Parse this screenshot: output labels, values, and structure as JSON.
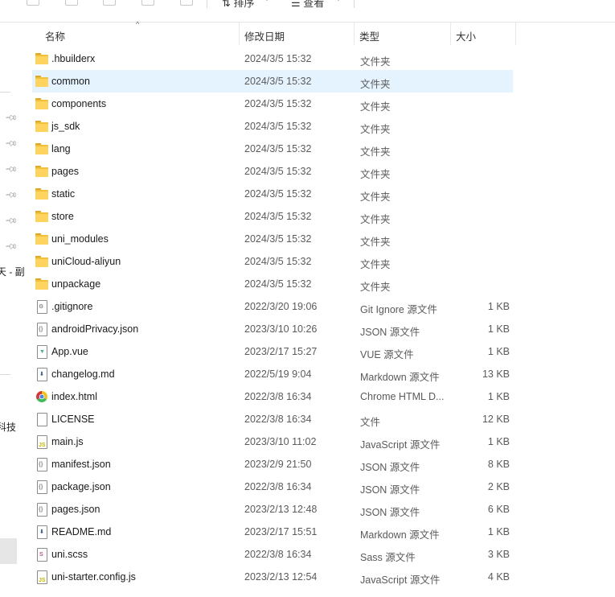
{
  "toolbar": {
    "sort_label": "排序",
    "view_label": "查看",
    "more_label": "···"
  },
  "nav": {
    "clip_text_1": "天 - 副",
    "clip_text_2": "科技"
  },
  "columns": {
    "name": "名称",
    "date": "修改日期",
    "type": "类型",
    "size": "大小"
  },
  "files": [
    {
      "name": ".hbuilderx",
      "date": "2024/3/5 15:32",
      "type": "文件夹",
      "size": "",
      "icon": "folder-icon"
    },
    {
      "name": "common",
      "date": "2024/3/5 15:32",
      "type": "文件夹",
      "size": "",
      "icon": "folder-icon",
      "selected": true
    },
    {
      "name": "components",
      "date": "2024/3/5 15:32",
      "type": "文件夹",
      "size": "",
      "icon": "folder-icon"
    },
    {
      "name": "js_sdk",
      "date": "2024/3/5 15:32",
      "type": "文件夹",
      "size": "",
      "icon": "folder-icon"
    },
    {
      "name": "lang",
      "date": "2024/3/5 15:32",
      "type": "文件夹",
      "size": "",
      "icon": "folder-icon"
    },
    {
      "name": "pages",
      "date": "2024/3/5 15:32",
      "type": "文件夹",
      "size": "",
      "icon": "folder-icon"
    },
    {
      "name": "static",
      "date": "2024/3/5 15:32",
      "type": "文件夹",
      "size": "",
      "icon": "folder-icon"
    },
    {
      "name": "store",
      "date": "2024/3/5 15:32",
      "type": "文件夹",
      "size": "",
      "icon": "folder-icon"
    },
    {
      "name": "uni_modules",
      "date": "2024/3/5 15:32",
      "type": "文件夹",
      "size": "",
      "icon": "folder-icon"
    },
    {
      "name": "uniCloud-aliyun",
      "date": "2024/3/5 15:32",
      "type": "文件夹",
      "size": "",
      "icon": "folder-icon"
    },
    {
      "name": "unpackage",
      "date": "2024/3/5 15:32",
      "type": "文件夹",
      "size": "",
      "icon": "folder-icon"
    },
    {
      "name": ".gitignore",
      "date": "2022/3/20 19:06",
      "type": "Git Ignore 源文件",
      "size": "1 KB",
      "icon": "gear-file-icon"
    },
    {
      "name": "androidPrivacy.json",
      "date": "2023/3/10 10:26",
      "type": "JSON 源文件",
      "size": "1 KB",
      "icon": "json-file-icon"
    },
    {
      "name": "App.vue",
      "date": "2023/2/17 15:27",
      "type": "VUE 源文件",
      "size": "1 KB",
      "icon": "vue-file-icon"
    },
    {
      "name": "changelog.md",
      "date": "2022/5/19 9:04",
      "type": "Markdown 源文件",
      "size": "13 KB",
      "icon": "markdown-file-icon"
    },
    {
      "name": "index.html",
      "date": "2022/3/8 16:34",
      "type": "Chrome HTML D...",
      "size": "1 KB",
      "icon": "chrome-icon"
    },
    {
      "name": "LICENSE",
      "date": "2022/3/8 16:34",
      "type": "文件",
      "size": "12 KB",
      "icon": "blank-file-icon"
    },
    {
      "name": "main.js",
      "date": "2023/3/10 11:02",
      "type": "JavaScript 源文件",
      "size": "1 KB",
      "icon": "js-file-icon"
    },
    {
      "name": "manifest.json",
      "date": "2023/2/9 21:50",
      "type": "JSON 源文件",
      "size": "8 KB",
      "icon": "json-file-icon"
    },
    {
      "name": "package.json",
      "date": "2022/3/8 16:34",
      "type": "JSON 源文件",
      "size": "2 KB",
      "icon": "json-file-icon"
    },
    {
      "name": "pages.json",
      "date": "2023/2/13 12:48",
      "type": "JSON 源文件",
      "size": "6 KB",
      "icon": "json-file-icon"
    },
    {
      "name": "README.md",
      "date": "2023/2/17 15:51",
      "type": "Markdown 源文件",
      "size": "1 KB",
      "icon": "markdown-file-icon"
    },
    {
      "name": "uni.scss",
      "date": "2022/3/8 16:34",
      "type": "Sass 源文件",
      "size": "3 KB",
      "icon": "sass-file-icon"
    },
    {
      "name": "uni-starter.config.js",
      "date": "2023/2/13 12:54",
      "type": "JavaScript 源文件",
      "size": "4 KB",
      "icon": "js-file-icon"
    }
  ],
  "colors": {
    "selection": "#e5f3ff",
    "folder": "#f2c13a",
    "js": "#c9b400",
    "json": "#8a8a8a",
    "vue": "#41b883",
    "markdown": "#2b5fa8",
    "sass": "#c6538c"
  }
}
